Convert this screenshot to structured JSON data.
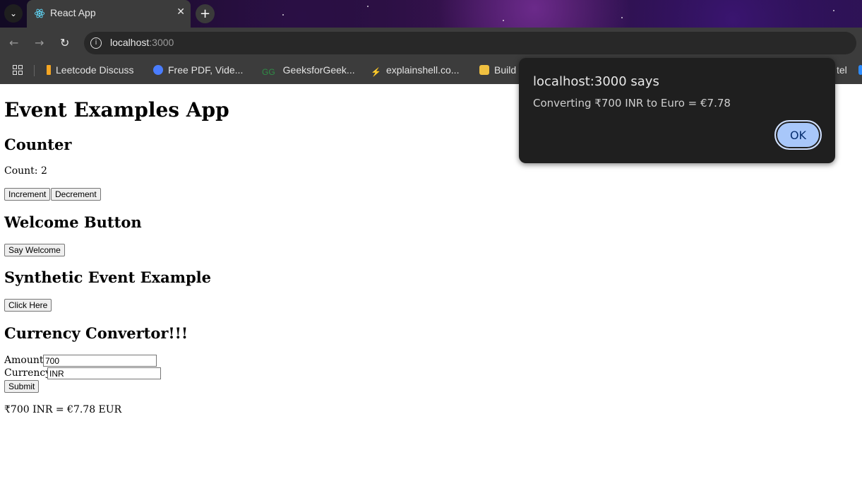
{
  "browser": {
    "tab": {
      "title": "React App",
      "close_glyph": "✕"
    },
    "new_tab_glyph": "+",
    "menu_glyph": "⌄",
    "address": {
      "host": "localhost",
      "port": ":3000"
    },
    "bookmarks": [
      {
        "label": "Leetcode Discuss",
        "color": "#f5a623"
      },
      {
        "label": "Free PDF, Vide...",
        "color": "#4a7dff"
      },
      {
        "label": "GeeksforGeek...",
        "color": "#2f8d46"
      },
      {
        "label": "explainshell.co...",
        "color": "#c04040"
      },
      {
        "label": "Build",
        "color": "#f0c040"
      },
      {
        "label": "tel",
        "color": "#3c3c3c"
      }
    ]
  },
  "page": {
    "title": "Event Examples App",
    "counter": {
      "heading": "Counter",
      "count_text": "Count: 2",
      "increment_label": "Increment",
      "decrement_label": "Decrement"
    },
    "welcome": {
      "heading": "Welcome Button",
      "button_label": "Say Welcome"
    },
    "synthetic": {
      "heading": "Synthetic Event Example",
      "button_label": "Click Here"
    },
    "currency": {
      "heading": "Currency Convertor!!!",
      "amount_label": "Amount:",
      "amount_value": "700",
      "currency_label": "Currency:",
      "currency_value": "INR",
      "submit_label": "Submit",
      "result_text": "₹700 INR = €7.78 EUR"
    }
  },
  "dialog": {
    "title": "localhost:3000 says",
    "message": "Converting ₹700 INR to Euro = €7.78",
    "ok_label": "OK"
  }
}
